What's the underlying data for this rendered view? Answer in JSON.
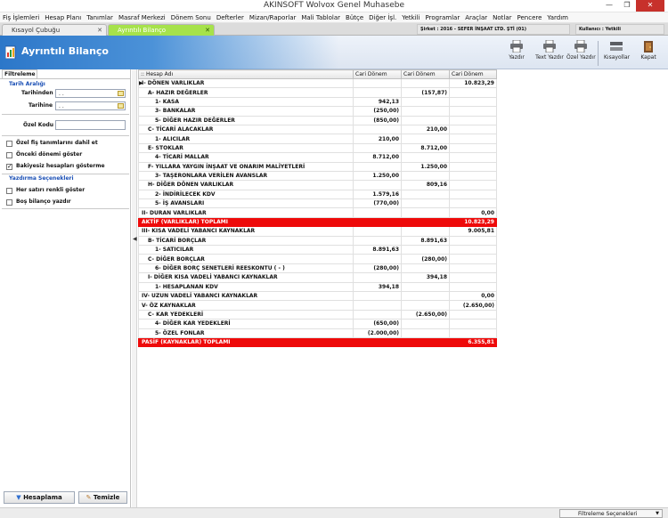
{
  "window": {
    "title": "AKINSOFT Wolvox Genel Muhasebe",
    "minimize": "—",
    "maximize": "❐",
    "close": "✕"
  },
  "menu": [
    "Fiş İşlemleri",
    "Hesap Planı",
    "Tanımlar",
    "Masraf Merkezi",
    "Dönem Sonu",
    "Defterler",
    "Mizan/Raporlar",
    "Mali Tablolar",
    "Bütçe",
    "Diğer İşl.",
    "Yetkili",
    "Programlar",
    "Araçlar",
    "Notlar",
    "Pencere",
    "Yardım"
  ],
  "tabs": [
    {
      "label": "Kısayol Çubuğu",
      "close": "✕"
    },
    {
      "label": "Ayrıntılı Bilanço",
      "close": "✕"
    }
  ],
  "company": "Şirket : 2016 - SEFER İNŞAAT LTD. ŞTİ (01)",
  "user": "Kullanıcı : Yetkili",
  "header": {
    "title": "Ayrıntılı Bilanço"
  },
  "toolbar": {
    "print": "Yazdır",
    "text_print": "Text Yazdır",
    "custom_print": "Özel Yazdır",
    "shortcuts": "Kısayollar",
    "close": "Kapat"
  },
  "filter": {
    "tab": "Filtreleme",
    "date_range": "Tarih Aralığı",
    "date_from_label": "Tarihinden",
    "date_from_value": ". .",
    "date_to_label": "Tarihine",
    "date_to_value": ". .",
    "special_code_label": "Özel Kodu",
    "options": [
      {
        "label": "Özel fiş tanımlarını dahil et",
        "checked": false
      },
      {
        "label": "Önceki dönemi göster",
        "checked": false
      },
      {
        "label": "Bakiyesiz hesapları gösterme",
        "checked": true
      }
    ],
    "print_options_title": "Yazdırma Seçenekleri",
    "print_options": [
      {
        "label": "Her satırı renkli göster",
        "checked": false
      },
      {
        "label": "Boş bilanço yazdır",
        "checked": false
      }
    ],
    "filter_button": "Hesaplama",
    "clear_button": "Temizle"
  },
  "grid": {
    "headers": [
      ":: Hesap Adı",
      "Cari Dönem",
      "Cari Dönem",
      "Cari Dönem"
    ],
    "pointer": "▶",
    "rows": [
      {
        "name": "I-   DÖNEN VARLIKLAR",
        "c1": "",
        "c2": "",
        "c3": "10.823,29",
        "indent": 0
      },
      {
        "name": "A-  HAZIR DEĞERLER",
        "c1": "",
        "c2": "(157,87)",
        "c3": "",
        "indent": 1
      },
      {
        "name": "1-  KASA",
        "c1": "942,13",
        "c2": "",
        "c3": "",
        "indent": 2
      },
      {
        "name": "3-  BANKALAR",
        "c1": "(250,00)",
        "c2": "",
        "c3": "",
        "indent": 2
      },
      {
        "name": "5-  DİĞER HAZIR DEĞERLER",
        "c1": "(850,00)",
        "c2": "",
        "c3": "",
        "indent": 2
      },
      {
        "name": "C-  TİCARİ ALACAKLAR",
        "c1": "",
        "c2": "210,00",
        "c3": "",
        "indent": 1
      },
      {
        "name": "1-  ALICILAR",
        "c1": "210,00",
        "c2": "",
        "c3": "",
        "indent": 2
      },
      {
        "name": "E-  STOKLAR",
        "c1": "",
        "c2": "8.712,00",
        "c3": "",
        "indent": 1
      },
      {
        "name": "4-  TİCARİ MALLAR",
        "c1": "8.712,00",
        "c2": "",
        "c3": "",
        "indent": 2
      },
      {
        "name": "F-  YILLARA YAYGIN İNŞAAT VE ONARIM MALİYETLERİ",
        "c1": "",
        "c2": "1.250,00",
        "c3": "",
        "indent": 1
      },
      {
        "name": "3-  TAŞERONLARA VERİLEN AVANSLAR",
        "c1": "1.250,00",
        "c2": "",
        "c3": "",
        "indent": 2
      },
      {
        "name": "H-  DİĞER DÖNEN VARLIKLAR",
        "c1": "",
        "c2": "809,16",
        "c3": "",
        "indent": 1
      },
      {
        "name": "2-  İNDİRİLECEK KDV",
        "c1": "1.579,16",
        "c2": "",
        "c3": "",
        "indent": 2
      },
      {
        "name": "5-  İŞ AVANSLARI",
        "c1": "(770,00)",
        "c2": "",
        "c3": "",
        "indent": 2
      },
      {
        "name": "II-  DURAN VARLIKLAR",
        "c1": "",
        "c2": "",
        "c3": "0,00",
        "indent": 0
      },
      {
        "name": "AKTİF (VARLIKLAR) TOPLAMI",
        "c1": "",
        "c2": "",
        "c3": "10.823,29",
        "indent": 0,
        "total": true
      },
      {
        "name": "III-   KISA VADELİ YABANCI KAYNAKLAR",
        "c1": "",
        "c2": "",
        "c3": "9.005,81",
        "indent": 0
      },
      {
        "name": "B-  TİCARİ BORÇLAR",
        "c1": "",
        "c2": "8.891,63",
        "c3": "",
        "indent": 1
      },
      {
        "name": "1-  SATICILAR",
        "c1": "8.891,63",
        "c2": "",
        "c3": "",
        "indent": 2
      },
      {
        "name": "C-  DİĞER BORÇLAR",
        "c1": "",
        "c2": "(280,00)",
        "c3": "",
        "indent": 1
      },
      {
        "name": "6-  DİĞER BORÇ SENETLERİ REESKONTU ( - )",
        "c1": "(280,00)",
        "c2": "",
        "c3": "",
        "indent": 2
      },
      {
        "name": "I-  DİĞER KISA VADELİ YABANCI KAYNAKLAR",
        "c1": "",
        "c2": "394,18",
        "c3": "",
        "indent": 1
      },
      {
        "name": "1-  HESAPLANAN KDV",
        "c1": "394,18",
        "c2": "",
        "c3": "",
        "indent": 2
      },
      {
        "name": "IV-  UZUN VADELİ YABANCI KAYNAKLAR",
        "c1": "",
        "c2": "",
        "c3": "0,00",
        "indent": 0
      },
      {
        "name": "V-  ÖZ KAYNAKLAR",
        "c1": "",
        "c2": "",
        "c3": "(2.650,00)",
        "indent": 0
      },
      {
        "name": "C-  KAR YEDEKLERİ",
        "c1": "",
        "c2": "(2.650,00)",
        "c3": "",
        "indent": 1
      },
      {
        "name": "4-  DİĞER KAR YEDEKLERİ",
        "c1": "(650,00)",
        "c2": "",
        "c3": "",
        "indent": 2
      },
      {
        "name": "5-  ÖZEL FONLAR",
        "c1": "(2.000,00)",
        "c2": "",
        "c3": "",
        "indent": 2
      },
      {
        "name": "PASİF (KAYNAKLAR) TOPLAMI",
        "c1": "",
        "c2": "",
        "c3": "6.355,81",
        "indent": 0,
        "total": true
      }
    ]
  },
  "status": {
    "filter_options": "Filtreleme Seçenekleri",
    "dropdown": "▼"
  },
  "colors": {
    "header_blue": "#2c77c9",
    "active_tab": "#a6e24b",
    "total_row": "#ee0a0a",
    "section_label": "#1a4fb5"
  }
}
